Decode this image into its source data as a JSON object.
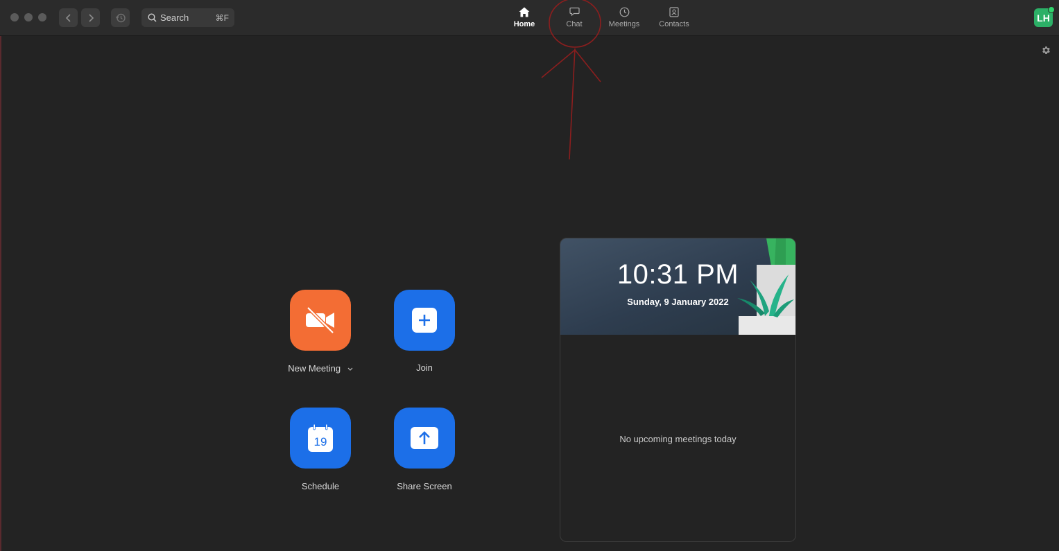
{
  "window": {
    "traffic_lights": [
      "close",
      "minimize",
      "zoom"
    ],
    "back_icon": "chevron-left-icon",
    "forward_icon": "chevron-right-icon",
    "history_icon": "history-icon"
  },
  "search": {
    "placeholder": "Search",
    "shortcut": "⌘F",
    "icon": "search-icon"
  },
  "tabs": [
    {
      "label": "Home",
      "icon": "home-icon",
      "active": true
    },
    {
      "label": "Chat",
      "icon": "chat-bubble-icon",
      "active": false
    },
    {
      "label": "Meetings",
      "icon": "clock-icon",
      "active": false
    },
    {
      "label": "Contacts",
      "icon": "contact-card-icon",
      "active": false
    }
  ],
  "user": {
    "initials": "LH",
    "status": "online",
    "avatar_color": "#2cb067",
    "status_color": "#2fd36b"
  },
  "settings": {
    "icon": "gear-icon"
  },
  "actions": [
    {
      "label": "New Meeting",
      "icon": "video-off-icon",
      "color": "#f36d34",
      "has_dropdown": true
    },
    {
      "label": "Join",
      "icon": "plus-icon",
      "color": "#1c6fe8"
    },
    {
      "label": "Schedule",
      "icon": "calendar-icon",
      "calendar_day": "19",
      "color": "#1c6fe8"
    },
    {
      "label": "Share Screen",
      "icon": "share-up-arrow-icon",
      "color": "#1c6fe8"
    }
  ],
  "meeting_card": {
    "time": "10:31 PM",
    "date": "Sunday, 9 January 2022",
    "empty_message": "No upcoming meetings today"
  },
  "annotation": {
    "color": "#8b1e1e",
    "target": "Chat"
  }
}
